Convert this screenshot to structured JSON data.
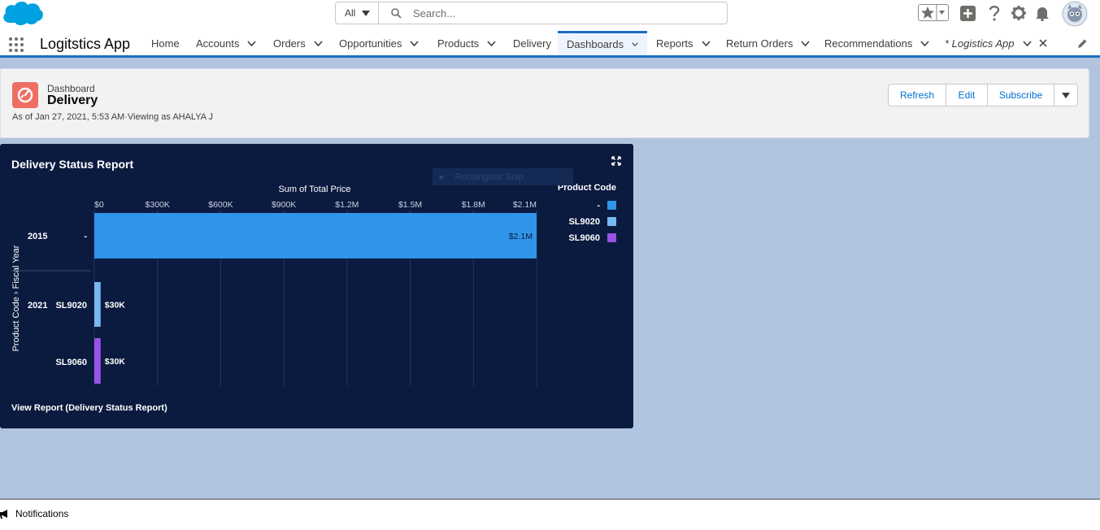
{
  "header": {
    "search_scope": "All",
    "search_placeholder": "Search...",
    "icons": [
      "salesforce-cloud-icon",
      "favorites-star-icon",
      "add-icon",
      "help-icon",
      "setup-gear-icon",
      "notifications-bell-icon",
      "user-avatar"
    ]
  },
  "nav": {
    "app_name": "Logitstics App",
    "tabs": [
      {
        "label": "Home"
      },
      {
        "label": "Accounts"
      },
      {
        "label": "Orders"
      },
      {
        "label": "Opportunities"
      },
      {
        "label": "Products"
      },
      {
        "label": "Delivery"
      },
      {
        "label": "Dashboards"
      },
      {
        "label": "Reports"
      },
      {
        "label": "Return Orders"
      },
      {
        "label": "Recommendations"
      },
      {
        "label": "* Logistics App"
      }
    ],
    "active_tab": "Dashboards"
  },
  "page_header": {
    "object_type": "Dashboard",
    "title": "Delivery",
    "meta": "As of Jan 27, 2021, 5:53 AM·Viewing as AHALYA J",
    "buttons": {
      "refresh": "Refresh",
      "edit": "Edit",
      "subscribe": "Subscribe"
    }
  },
  "report": {
    "title": "Delivery Status Report",
    "view_report": "View Report (Delivery Status Report)",
    "overlay_text": "Rectangular Snip"
  },
  "chart_data": {
    "type": "bar",
    "orientation": "horizontal",
    "title": "Sum of Total Price",
    "ylabel": "Product Code > Fiscal Year",
    "xlim": [
      0,
      2100000
    ],
    "x_ticks": [
      "$0",
      "$300K",
      "$600K",
      "$900K",
      "$1.2M",
      "$1.5M",
      "$1.8M",
      "$2.1M"
    ],
    "legend_title": "Product Code",
    "legend_position": "right",
    "series": [
      {
        "name": "-",
        "color": "#2f95e9"
      },
      {
        "name": "SL9020",
        "color": "#78b8f2"
      },
      {
        "name": "SL9060",
        "color": "#9a53e8"
      }
    ],
    "groups": [
      {
        "year": "2015",
        "bars": [
          {
            "code": "-",
            "value": 2100000,
            "label": "$2.1M"
          }
        ]
      },
      {
        "year": "2021",
        "bars": [
          {
            "code": "SL9020",
            "value": 30000,
            "label": "$30K"
          },
          {
            "code": "SL9060",
            "value": 30000,
            "label": "$30K"
          }
        ]
      }
    ]
  },
  "footer": {
    "notifications_label": "Notifications"
  }
}
